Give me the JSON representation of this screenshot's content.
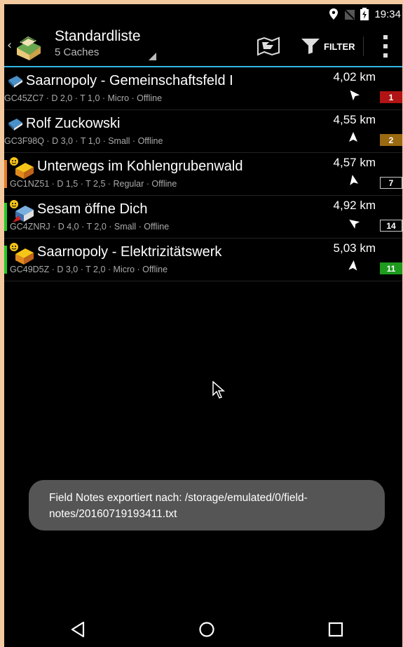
{
  "status": {
    "time": "19:34"
  },
  "appbar": {
    "title": "Standardliste",
    "subtitle": "5 Caches",
    "filter_label": "FILTER"
  },
  "caches": [
    {
      "name": "Saarnopoly - Gemeinschaftsfeld I",
      "info": "GC45ZC7 · D 2,0 · T 1,0 · Micro · Offline",
      "distance": "4,02 km",
      "badge": "1",
      "badge_color": "#b01414",
      "stripe": "",
      "icon": "virtual-cache-icon"
    },
    {
      "name": "Rolf Zuckowski",
      "info": "GC3F98Q · D 3,0 · T 1,0 · Small · Offline",
      "distance": "4,55 km",
      "badge": "2",
      "badge_color": "#9a6a12",
      "stripe": "",
      "icon": "virtual-cache-icon"
    },
    {
      "name": "Unterwegs im Kohlengrubenwald",
      "info": "GC1NZ51 · D 1,5 · T 2,5 · Regular · Offline",
      "distance": "4,57 km",
      "badge": "7",
      "badge_color": "#000000",
      "stripe": "#e67e22",
      "icon": "multi-cache-icon"
    },
    {
      "name": "Sesam öffne Dich",
      "info": "GC4ZNRJ · D 4,0 · T 2,0 · Small · Offline",
      "distance": "4,92 km",
      "badge": "14",
      "badge_color": "#000000",
      "stripe": "#22cc22",
      "icon": "mystery-cache-icon"
    },
    {
      "name": "Saarnopoly - Elektrizitätswerk",
      "info": "GC49D5Z · D 3,0 · T 2,0 · Micro · Offline",
      "distance": "5,03 km",
      "badge": "11",
      "badge_color": "#1e9a1e",
      "stripe": "#22cc22",
      "icon": "multi-cache-icon"
    }
  ],
  "toast": {
    "line1": "Field Notes exportiert nach: /storage/emulated/0/field-",
    "line2": "notes/20160719193411.txt"
  }
}
